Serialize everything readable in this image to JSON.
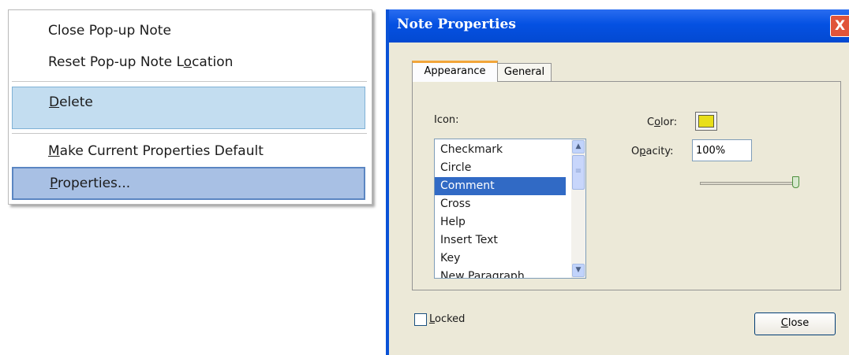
{
  "context_menu": {
    "items": [
      {
        "label": "Close Pop-up Note"
      },
      {
        "pre": "Reset Pop-up Note L",
        "key": "o",
        "post": "cation"
      },
      {
        "pre": "",
        "key": "D",
        "post": "elete"
      },
      {
        "pre": "",
        "key": "M",
        "post": "ake Current Properties Default"
      },
      {
        "pre": "",
        "key": "P",
        "post": "roperties..."
      }
    ]
  },
  "dialog": {
    "title": "Note Properties",
    "close_glyph": "X",
    "tabs": {
      "appearance": "Appearance",
      "general": "General"
    },
    "icon_label": "Icon:",
    "color_label": {
      "pre": "C",
      "key": "o",
      "post": "lor:"
    },
    "color_value": "#e8df1a",
    "opacity_label": {
      "pre": "O",
      "key": "p",
      "post": "acity:"
    },
    "opacity_value": "100%",
    "opacity_level": 1.0,
    "icon_list": {
      "items": [
        "Checkmark",
        "Circle",
        "Comment",
        "Cross",
        "Help",
        "Insert Text",
        "Key",
        "New Paragraph"
      ],
      "selected": "Comment"
    },
    "locked": {
      "key": "L",
      "post": "ocked",
      "checked": false
    },
    "close_button": {
      "key": "C",
      "post": "lose"
    }
  },
  "icons": {
    "scroll_up": "▲",
    "scroll_down": "▼",
    "thumb_grip": "≡"
  },
  "colors": {
    "title_bar": "#0451e2",
    "list_selection": "#316ac5",
    "menu_hover": "#c3ddf0",
    "menu_selected": "#a8c0e4"
  }
}
